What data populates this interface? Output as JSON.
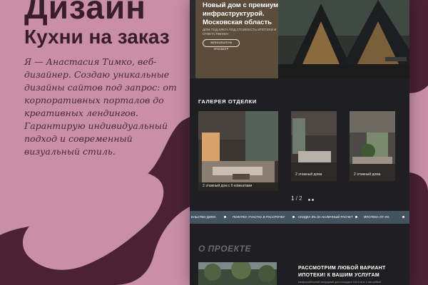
{
  "poster": {
    "title": "Дизайн",
    "subtitle": "Кухни на заказ",
    "intro": "Я — Анастасия Тимко, веб-дизайнер. Создаю уникальные дизайны сайтов под запрос: от корпоративных порталов до креативных лендингов. Гарантирую индивидуальный подход и современный визуальный стиль."
  },
  "mockup": {
    "hero": {
      "title": "Новый дом с премиум инфраструктурой. Московская область",
      "small": "ДОМ ПОД КЛЮЧ ПОД СТОИМОСТЬ ИПОТЕКИ И ОТВЕТСТВЕНЕН",
      "button": "ЗАПИСАТЬСЯ НА ПРОСМОТР"
    },
    "gallery": {
      "heading": "ГАЛЕРЕЯ ОТДЕЛКИ",
      "cards": [
        {
          "label": "2 этажный дом с 6 комнатами"
        },
        {
          "label": "2 этажный дома"
        },
        {
          "label": "2 этажный дома"
        }
      ],
      "pager_current": "1",
      "pager_total": "/ 2"
    },
    "ticker": [
      "ЕЛЬСТВО ДОМА",
      "ПОКУПКА УЧАСТКА В РАССРОЧКУ",
      "СКИДКА 5% ЗА НАЛИЧНЫЙ РАСЧЕТ",
      "ИПОТЕКА ОТ 6%"
    ],
    "about": {
      "heading": "О ПРОЕКТЕ",
      "mortgage_title": "РАССМОТРИМ ЛЮБОЙ ВАРИАНТ ИПОТЕКИ! К ВАШИМ УСЛУГАМ",
      "mortgage_small": "комфортабельный загородный дом площадью 151,6 кв.м. с застройкой"
    }
  },
  "colors": {
    "poster_bg": "#c98fa4",
    "blob": "#4a2233",
    "title_text": "#3a1d2a",
    "mockup_bg": "#1f1f21",
    "ticker_bg": "#44545e"
  }
}
